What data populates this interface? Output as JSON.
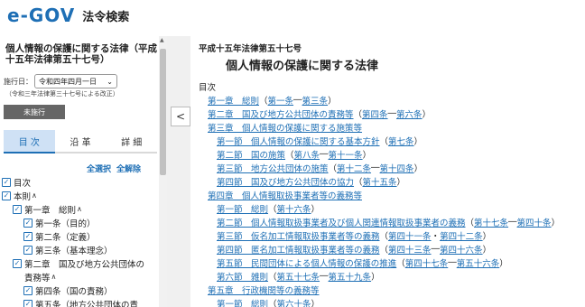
{
  "header": {
    "logo_text": "e-GOV",
    "app_title": "法令検索"
  },
  "left": {
    "law_title": "個人情報の保護に関する法律（平成十五年法律第五十七号）",
    "date_label": "施行日：",
    "date_value": "令和四年四月一日",
    "amend_note": "（令和三年法律第三十七号による改正）",
    "enforce_button": "未施行",
    "tabs": [
      "目 次",
      "沿 革",
      "詳 細"
    ],
    "select_all": "全選択",
    "deselect_all": "全解除",
    "tree": [
      {
        "label": "目次",
        "indent": 0,
        "chev": ""
      },
      {
        "label": "本則",
        "indent": 0,
        "chev": "∧"
      },
      {
        "label": "第一章　総則",
        "indent": 1,
        "chev": "∧"
      },
      {
        "label": "第一条（目的）",
        "indent": 2,
        "chev": ""
      },
      {
        "label": "第二条（定義）",
        "indent": 2,
        "chev": ""
      },
      {
        "label": "第三条（基本理念）",
        "indent": 2,
        "chev": ""
      },
      {
        "label": "第二章　国及び地方公共団体の",
        "indent": 1,
        "chev": ""
      },
      {
        "label": "責務等",
        "indent": 1,
        "chev": "∧",
        "nocb": true
      },
      {
        "label": "第四条（国の責務）",
        "indent": 2,
        "chev": ""
      },
      {
        "label": "第五条（地方公共団体の責",
        "indent": 2,
        "chev": ""
      }
    ]
  },
  "main": {
    "law_number": "平成十五年法律第五十七号",
    "title": "個人情報の保護に関する法律",
    "toc_heading": "目次",
    "toc": [
      {
        "level": 1,
        "link": "第一章　総則",
        "pre": "（",
        "refs": [
          "第一条",
          "第三条"
        ],
        "sep": "―",
        "post": "）"
      },
      {
        "level": 1,
        "link": "第二章　国及び地方公共団体の責務等",
        "pre": "（",
        "refs": [
          "第四条",
          "第六条"
        ],
        "sep": "―",
        "post": "）"
      },
      {
        "level": 1,
        "link": "第三章　個人情報の保護に関する施策等",
        "pre": "",
        "refs": [],
        "sep": "",
        "post": ""
      },
      {
        "level": 2,
        "link": "第一節　個人情報の保護に関する基本方針",
        "pre": "（",
        "refs": [
          "第七条"
        ],
        "sep": "",
        "post": "）"
      },
      {
        "level": 2,
        "link": "第二節　国の施策",
        "pre": "（",
        "refs": [
          "第八条",
          "第十一条"
        ],
        "sep": "―",
        "post": "）"
      },
      {
        "level": 2,
        "link": "第三節　地方公共団体の施策",
        "pre": "（",
        "refs": [
          "第十二条",
          "第十四条"
        ],
        "sep": "―",
        "post": "）"
      },
      {
        "level": 2,
        "link": "第四節　国及び地方公共団体の協力",
        "pre": "（",
        "refs": [
          "第十五条"
        ],
        "sep": "",
        "post": "）"
      },
      {
        "level": 1,
        "link": "第四章　個人情報取扱事業者等の義務等",
        "pre": "",
        "refs": [],
        "sep": "",
        "post": ""
      },
      {
        "level": 2,
        "link": "第一節　総則",
        "pre": "（",
        "refs": [
          "第十六条"
        ],
        "sep": "",
        "post": "）"
      },
      {
        "level": 2,
        "link": "第二節　個人情報取扱事業者及び個人関連情報取扱事業者の義務",
        "pre": "（",
        "refs": [
          "第十七条",
          "第四十条"
        ],
        "sep": "―",
        "post": "）"
      },
      {
        "level": 2,
        "link": "第三節　仮名加工情報取扱事業者等の義務",
        "pre": "（",
        "refs": [
          "第四十一条",
          "第四十二条"
        ],
        "sep": "・",
        "post": "）"
      },
      {
        "level": 2,
        "link": "第四節　匿名加工情報取扱事業者等の義務",
        "pre": "（",
        "refs": [
          "第四十三条",
          "第四十六条"
        ],
        "sep": "―",
        "post": "）"
      },
      {
        "level": 2,
        "link": "第五節　民間団体による個人情報の保護の推進",
        "pre": "（",
        "refs": [
          "第四十七条",
          "第五十六条"
        ],
        "sep": "―",
        "post": "）"
      },
      {
        "level": 2,
        "link": "第六節　雑則",
        "pre": "（",
        "refs": [
          "第五十七条",
          "第五十九条"
        ],
        "sep": "―",
        "post": "）"
      },
      {
        "level": 1,
        "link": "第五章　行政機関等の義務等",
        "pre": "",
        "refs": [],
        "sep": "",
        "post": ""
      },
      {
        "level": 2,
        "link": "第一節　総則",
        "pre": "（",
        "refs": [
          "第六十条"
        ],
        "sep": "",
        "post": "）"
      }
    ]
  }
}
